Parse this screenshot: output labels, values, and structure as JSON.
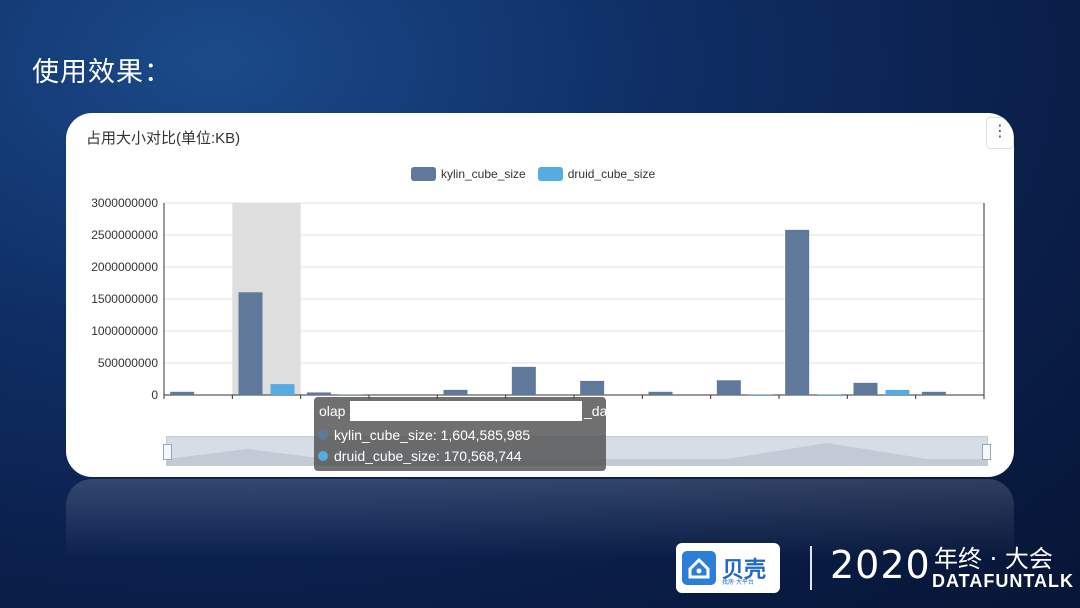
{
  "slide": {
    "title": "使用效果：",
    "logo_text": "贝壳",
    "logo_sub": "找房·大平台",
    "event_year": "2020",
    "event_name": "年终 · 大会",
    "event_sub": "DATAFUNTALK"
  },
  "colors": {
    "kylin": "#60799b",
    "druid": "#56ace0",
    "highlight": "#dedede",
    "background": "#0f2f66"
  },
  "chart_data": {
    "type": "bar",
    "title": "占用大小对比(单位:KB)",
    "ylim": [
      0,
      3000000000
    ],
    "yticks": [
      0,
      500000000,
      1000000000,
      1500000000,
      2000000000,
      2500000000,
      3000000000
    ],
    "ytick_labels": [
      "0",
      "500000000",
      "1000000000",
      "1500000000",
      "2000000000",
      "2500000000",
      "3000000000"
    ],
    "legend_position": "top-center",
    "grid": true,
    "highlighted_category_index": 1,
    "series": [
      {
        "name": "kylin_cube_size",
        "values": [
          50000000,
          1604585985,
          40000000,
          0,
          80000000,
          440000000,
          220000000,
          50000000,
          230000000,
          2580000000,
          190000000,
          50000000
        ]
      },
      {
        "name": "druid_cube_size",
        "values": [
          0,
          170568744,
          5000000,
          0,
          0,
          0,
          0,
          0,
          10000000,
          10000000,
          80000000,
          0
        ]
      }
    ],
    "tooltip": {
      "title_prefix": "olap",
      "title_suffix": "_da",
      "rows": [
        {
          "label": "kylin_cube_size: 1,604,585,985"
        },
        {
          "label": "druid_cube_size: 170,568,744"
        }
      ]
    }
  }
}
